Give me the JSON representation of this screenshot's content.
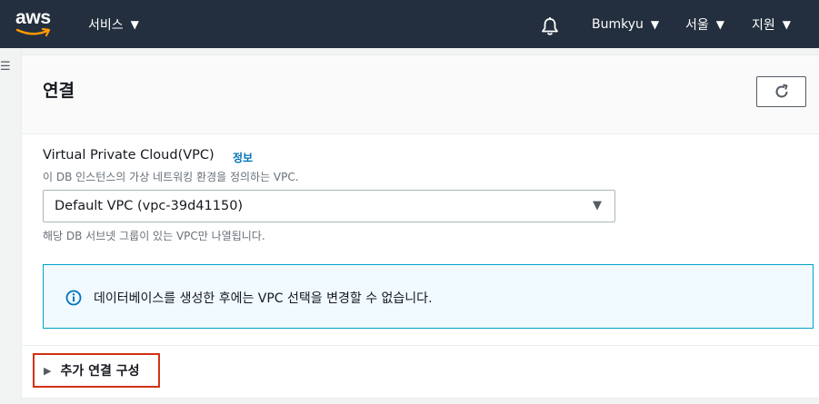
{
  "topnav": {
    "logo_text": "aws",
    "services_label": "서비스",
    "user_label": "Bumkyu",
    "region_label": "서울",
    "support_label": "지원"
  },
  "panel": {
    "title": "연결",
    "vpc_label": "Virtual Private Cloud(VPC)",
    "info_link": "정보",
    "vpc_description": "이 DB 인스턴스의 가상 네트워킹 환경을 정의하는 VPC.",
    "vpc_selected": "Default VPC (vpc-39d41150)",
    "vpc_constraint": "해당 DB 서브넷 그룹이 있는 VPC만 나열됩니다.",
    "alert_text": "데이터베이스를 생성한 후에는 VPC 선택을 변경할 수 없습니다.",
    "additional_config_label": "추가 연결 구성"
  },
  "colors": {
    "nav_bg": "#232f3e",
    "link": "#0073bb",
    "info_border": "#00a1c9",
    "info_bg": "#f1faff",
    "highlight": "#d13212",
    "aws_orange": "#ff9900"
  }
}
